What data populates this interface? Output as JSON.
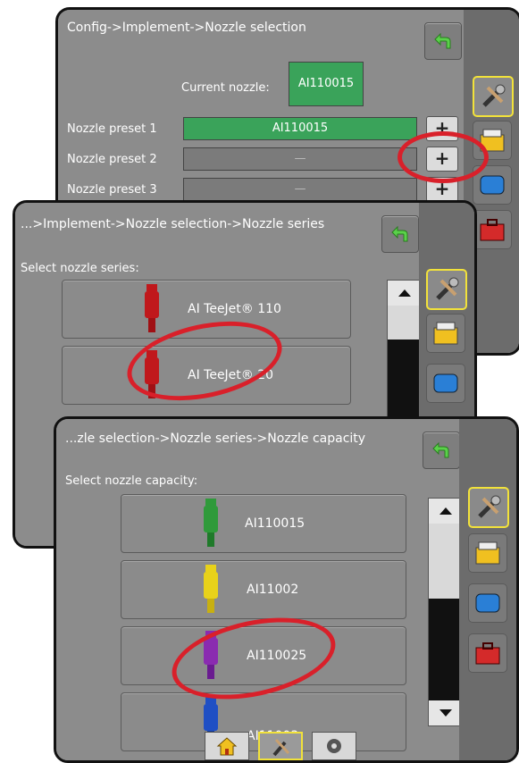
{
  "panel1": {
    "breadcrumb": "Config->Implement->Nozzle selection",
    "current_label": "Current nozzle:",
    "current_value": "AI110015",
    "presets": [
      {
        "label": "Nozzle preset 1",
        "value": "AI110015",
        "button": "+"
      },
      {
        "label": "Nozzle preset 2",
        "value": "—",
        "button": "+"
      },
      {
        "label": "Nozzle preset 3",
        "value": "—",
        "button": "+"
      }
    ]
  },
  "panel2": {
    "breadcrumb": "...>Implement->Nozzle selection->Nozzle series",
    "prompt": "Select nozzle series:",
    "options": [
      {
        "label": "AI TeeJet® 110",
        "color": "#c0181c"
      },
      {
        "label": "AI TeeJet® 20",
        "color": "#c0181c"
      }
    ]
  },
  "panel3": {
    "breadcrumb": "...zle selection->Nozzle series->Nozzle capacity",
    "prompt": "Select nozzle capacity:",
    "options": [
      {
        "label": "AI110015",
        "color": "#2f9a3a"
      },
      {
        "label": "AI11002",
        "color": "#e8d21a"
      },
      {
        "label": "AI110025",
        "color": "#8a2bb0"
      },
      {
        "label": "AI11003",
        "color": "#1f4fc4"
      }
    ]
  },
  "bottom_tabs": [
    "home-icon",
    "tools-icon",
    "gear-icon"
  ],
  "rail_icons": [
    "tools-icon",
    "implement-icon",
    "display-icon",
    "toolbox-icon"
  ],
  "colors": {
    "highlight_ring": "#d9202a",
    "active_outline": "#f2e23a"
  }
}
